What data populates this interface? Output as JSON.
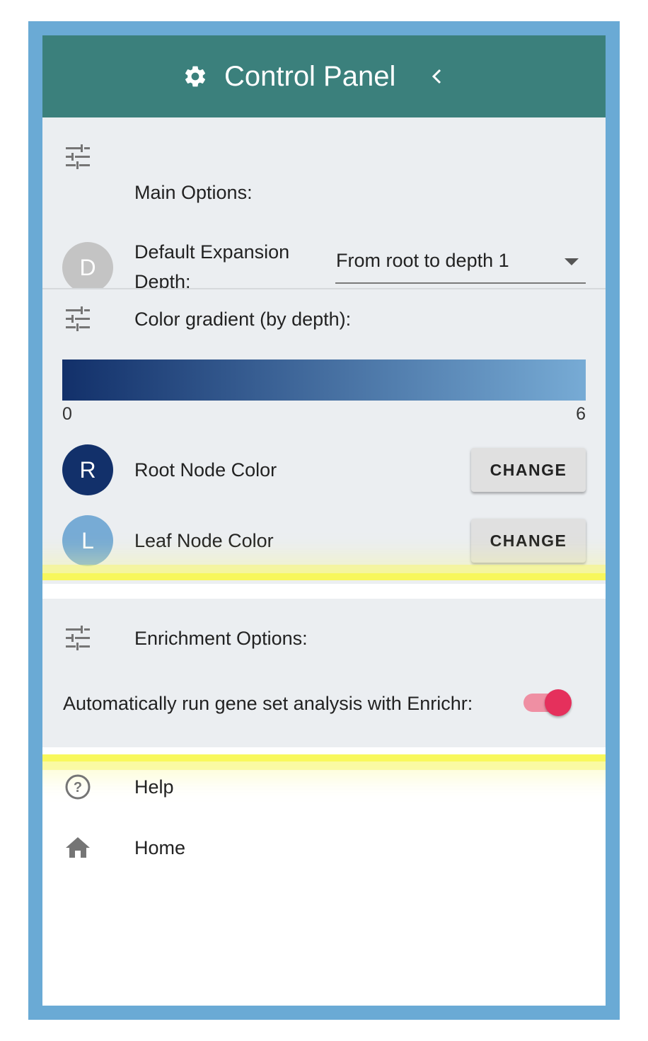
{
  "header": {
    "title": "Control Panel"
  },
  "main_options": {
    "label": "Main Options:",
    "expansion": {
      "avatar_letter": "D",
      "label": "Default Expansion Depth:",
      "selected": "From root to depth 1"
    }
  },
  "color_options": {
    "label": "Color gradient (by depth):",
    "gradient": {
      "min": "0",
      "max": "6",
      "start_color": "#12306a",
      "end_color": "#77abd5"
    },
    "root": {
      "avatar_letter": "R",
      "label": "Root Node Color",
      "button": "CHANGE",
      "color": "#12306a"
    },
    "leaf": {
      "avatar_letter": "L",
      "label": "Leaf Node Color",
      "button": "CHANGE",
      "color": "#77abd5"
    }
  },
  "enrichment": {
    "label": "Enrichment Options:",
    "auto_run_label": "Automatically run gene set analysis with Enrichr:",
    "auto_run_enabled": true
  },
  "nav": [
    {
      "label": "Help",
      "icon": "help-circle-icon"
    },
    {
      "label": "Home",
      "icon": "home-icon"
    }
  ],
  "colors": {
    "header": "#3b807c",
    "frame": "#6aaad5",
    "toggle": "#e5305c",
    "highlight": "#f7f750"
  }
}
